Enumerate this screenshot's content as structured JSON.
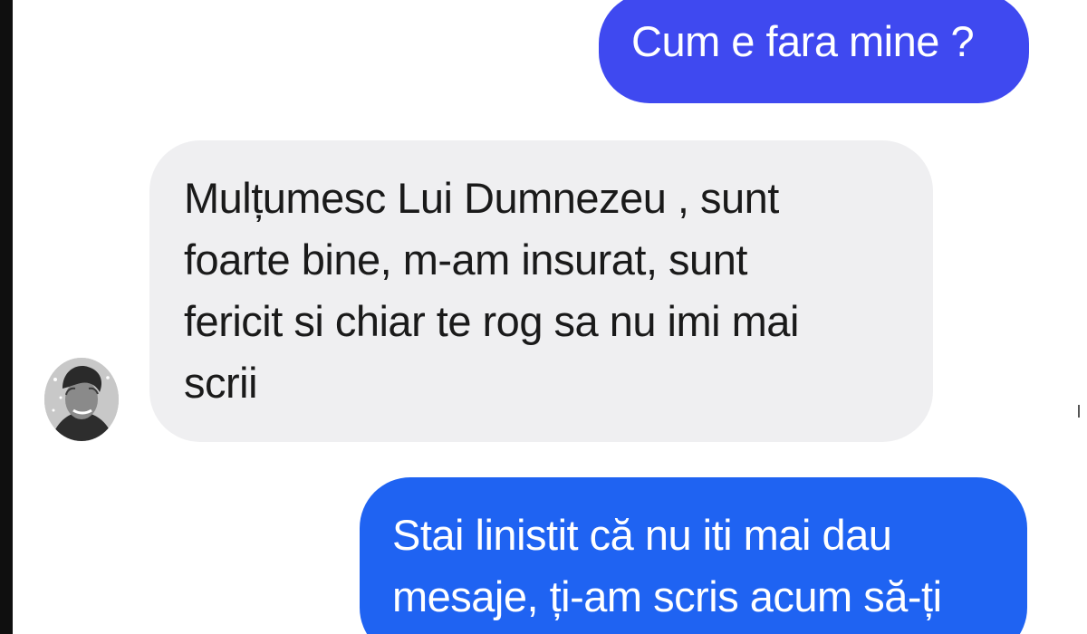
{
  "conversation": {
    "colors": {
      "outgoing_top": "#3f49f0",
      "outgoing_bottom": "#1f63f2",
      "incoming": "#efeff1",
      "incoming_text": "#1a1a1a",
      "outgoing_text": "#ffffff"
    },
    "messages": [
      {
        "direction": "outgoing",
        "text": "Cum e fara mine ?"
      },
      {
        "direction": "incoming",
        "text": "Mulțumesc Lui Dumnezeu  , sunt\nfoarte bine, m-am insurat, sunt\nfericit si chiar te rog sa nu imi mai\nscrii"
      },
      {
        "direction": "outgoing",
        "text": "Stai linistit că nu iti mai dau\nmesaje, ți-am scris acum să-ți"
      }
    ],
    "contact": {
      "avatar_icon": "user-photo-avatar"
    }
  }
}
